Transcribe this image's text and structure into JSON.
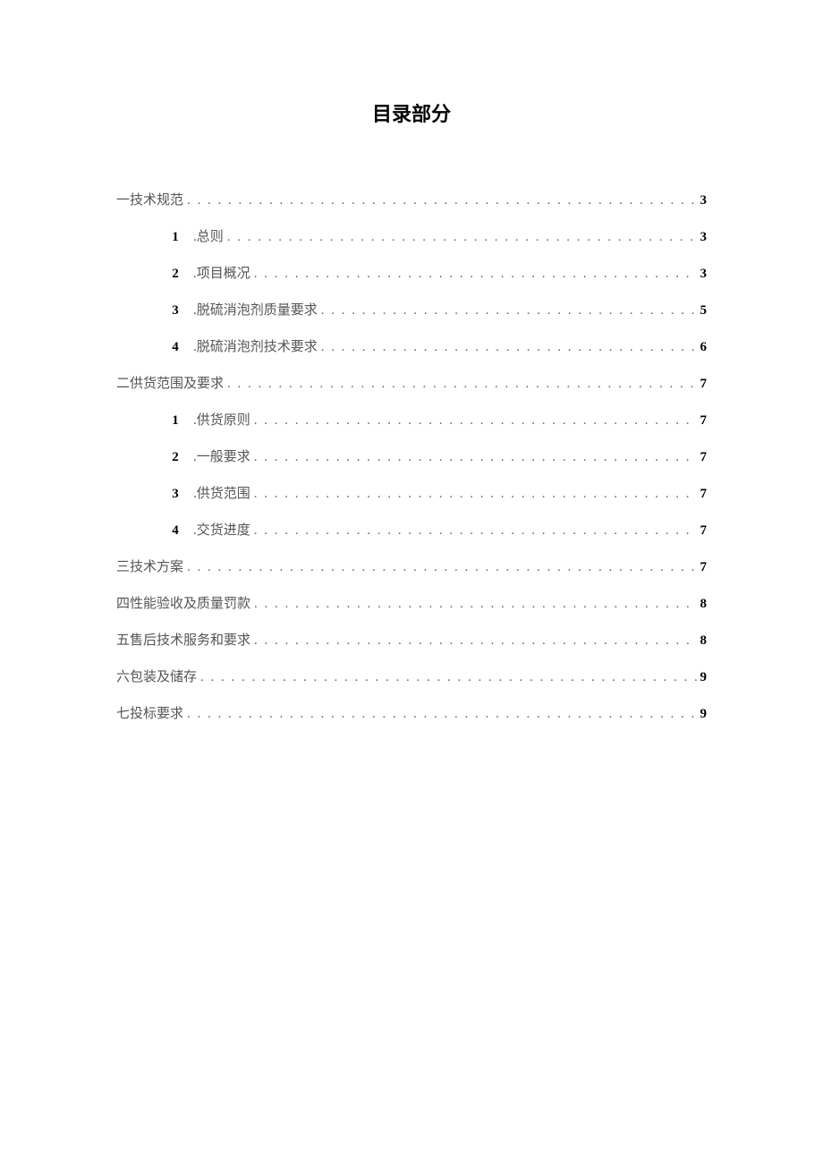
{
  "title": "目录部分",
  "toc": [
    {
      "level": 1,
      "num": "",
      "label": "一技术规范",
      "page": "3"
    },
    {
      "level": 2,
      "num": "1",
      "label": ".总则",
      "page": "3"
    },
    {
      "level": 2,
      "num": "2",
      "label": ".项目概况",
      "page": "3"
    },
    {
      "level": 2,
      "num": "3",
      "label": ".脱硫消泡剂质量要求",
      "page": "5"
    },
    {
      "level": 2,
      "num": "4",
      "label": ".脱硫消泡剂技术要求",
      "page": "6"
    },
    {
      "level": 1,
      "num": "",
      "label": "二供货范围及要求",
      "page": "7"
    },
    {
      "level": 2,
      "num": "1",
      "label": ".供货原则",
      "page": "7"
    },
    {
      "level": 2,
      "num": "2",
      "label": ".一般要求",
      "page": "7"
    },
    {
      "level": 2,
      "num": "3",
      "label": ".供货范围",
      "page": "7"
    },
    {
      "level": 2,
      "num": "4",
      "label": ".交货进度",
      "page": "7"
    },
    {
      "level": 1,
      "num": "",
      "label": "三技术方案",
      "page": "7"
    },
    {
      "level": 1,
      "num": "",
      "label": "四性能验收及质量罚款",
      "page": "8"
    },
    {
      "level": 1,
      "num": "",
      "label": "五售后技术服务和要求",
      "page": "8"
    },
    {
      "level": 1,
      "num": "",
      "label": "六包装及储存",
      "page": "9"
    },
    {
      "level": 1,
      "num": "",
      "label": "七投标要求",
      "page": "9"
    }
  ]
}
